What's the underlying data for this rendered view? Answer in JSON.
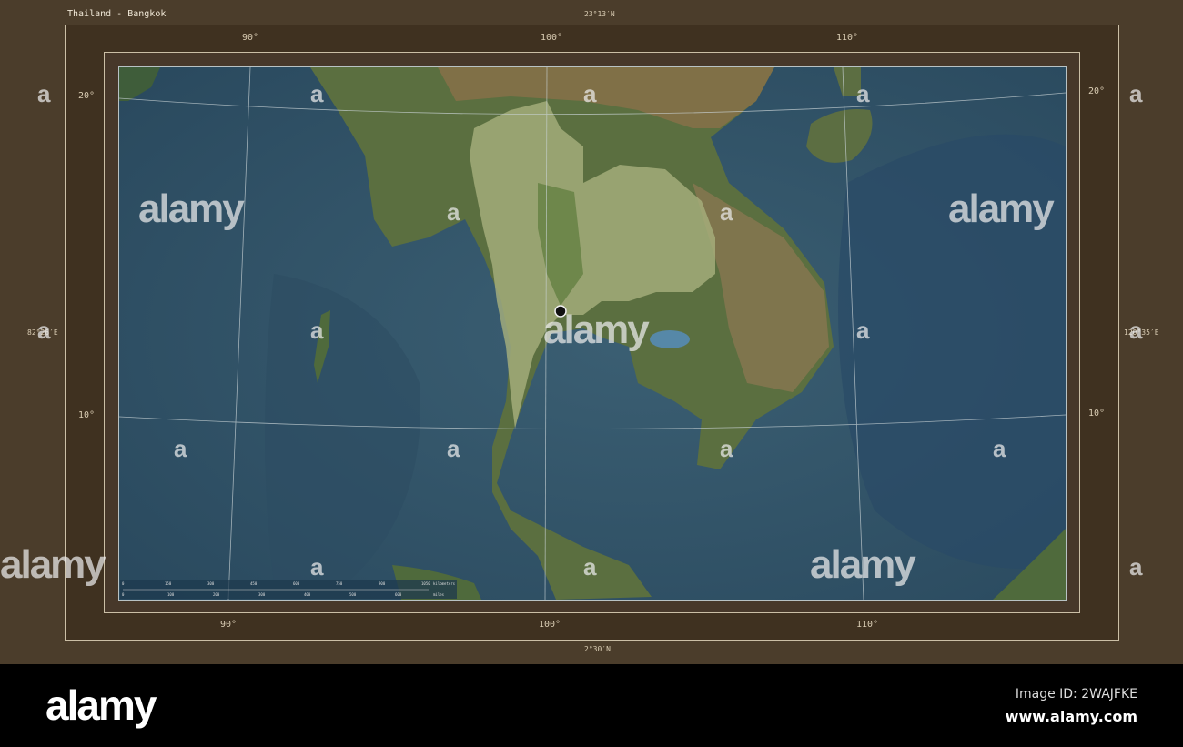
{
  "map": {
    "title": "Thailand - Bangkok",
    "extent": {
      "north": "23°13′N",
      "south": "2°30′N",
      "west": "82°26′E",
      "east": "120°35′E"
    },
    "longitude_ticks": [
      "90°",
      "100°",
      "110°"
    ],
    "latitude_ticks": [
      "20°",
      "10°"
    ],
    "highlighted_region": "Thailand",
    "marker": "Bangkok",
    "colors": {
      "frame": "#4b3d2b",
      "ocean": "#2f4f63",
      "land": "#5f7445",
      "highlight": "#a9b27e",
      "marker": "#111111"
    },
    "scale_bar": {
      "km_ticks": [
        "0",
        "150",
        "300",
        "450",
        "600",
        "750",
        "900",
        "1050"
      ],
      "km_unit": "kilometers",
      "mi_ticks": [
        "0",
        "100",
        "200",
        "300",
        "400",
        "500",
        "600"
      ],
      "mi_unit": "miles"
    }
  },
  "watermark": {
    "text": "alamy",
    "letter": "a"
  },
  "footer": {
    "logo": "alamy",
    "image_id": "Image ID: 2WAJFKE",
    "site": "www.alamy.com"
  }
}
